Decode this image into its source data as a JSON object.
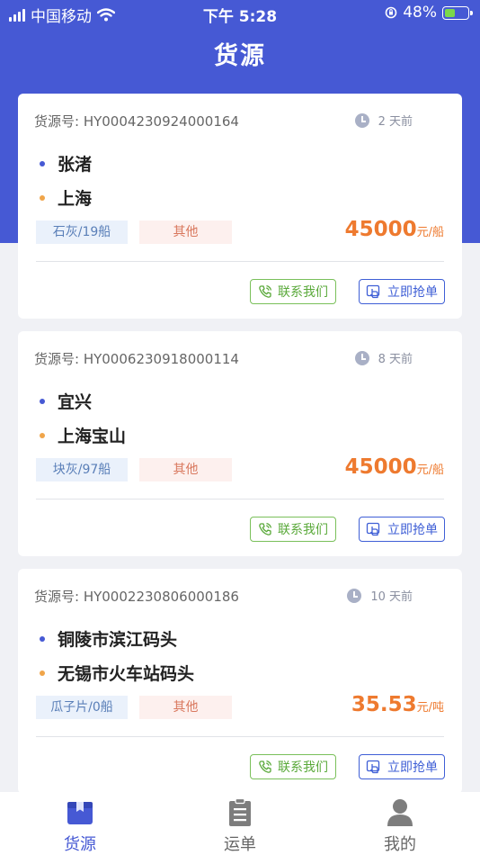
{
  "status_bar": {
    "carrier": "中国移动",
    "time": "下午 5:28",
    "battery_percent": "48%",
    "battery_level": 0.48
  },
  "header": {
    "title": "货源"
  },
  "cards": [
    {
      "number_label": "货源号: HY0004230924000164",
      "time_ago": "2 天前",
      "origin": "张渚",
      "destination": "上海",
      "cargo_tag": "石灰/19船",
      "type_tag": "其他",
      "price": "45000",
      "price_unit": "元/船",
      "contact_label": "联系我们",
      "grab_label": "立即抢单"
    },
    {
      "number_label": "货源号: HY0006230918000114",
      "time_ago": "8 天前",
      "origin": "宜兴",
      "destination": "上海宝山",
      "cargo_tag": "块灰/97船",
      "type_tag": "其他",
      "price": "45000",
      "price_unit": "元/船",
      "contact_label": "联系我们",
      "grab_label": "立即抢单"
    },
    {
      "number_label": "货源号: HY0002230806000186",
      "time_ago": "10 天前",
      "origin": "铜陵市滨江码头",
      "destination": "无锡市火车站码头",
      "cargo_tag": "瓜子片/0船",
      "type_tag": "其他",
      "price": "35.53",
      "price_unit": "元/吨",
      "contact_label": "联系我们",
      "grab_label": "立即抢单"
    }
  ],
  "tab_bar": {
    "items": [
      {
        "label": "货源",
        "icon": "box-icon",
        "active": true
      },
      {
        "label": "运单",
        "icon": "clipboard-icon",
        "active": false
      },
      {
        "label": "我的",
        "icon": "user-icon",
        "active": false
      }
    ]
  },
  "colors": {
    "brand": "#4659d4",
    "price": "#ee7a2f",
    "contact": "#5aa93a",
    "grab": "#3f5fd6"
  }
}
